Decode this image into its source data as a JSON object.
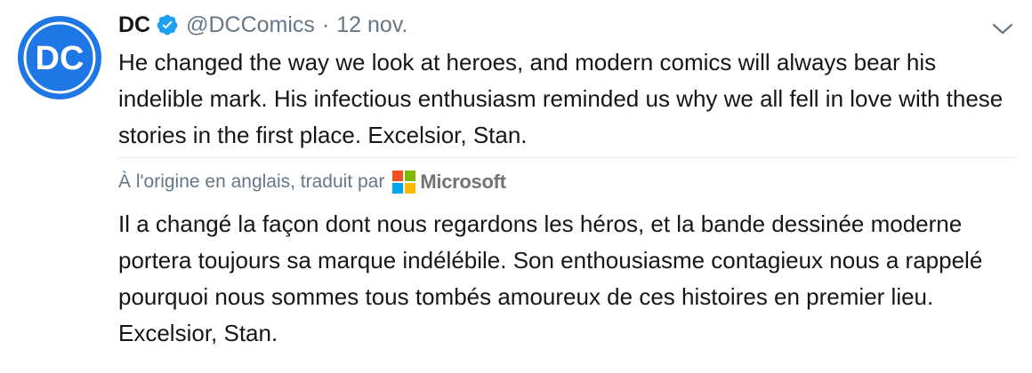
{
  "tweet": {
    "display_name": "DC",
    "handle": "@DCComics",
    "separator": "·",
    "timestamp": "12 nov.",
    "text": "He changed the way we look at heroes, and modern comics will always bear his indelible mark. His infectious enthusiasm reminded us why we all fell in love with these stories in the first place. Excelsior, Stan.",
    "avatar_text": "DC",
    "icons": {
      "verified": "verified-badge-icon",
      "caret": "chevron-down-icon",
      "translator_logo": "microsoft-logo-icon"
    }
  },
  "translation": {
    "label": "À l'origine en anglais, traduit par",
    "provider": "Microsoft",
    "text": "Il a changé la façon dont nous regardons les héros, et la bande dessinée moderne portera toujours sa marque indélébile. Son enthousiasme contagieux nous a rappelé pourquoi nous sommes tous tombés amoureux de ces histoires en premier lieu. Excelsior, Stan."
  },
  "colors": {
    "avatar_blue": "#1f77e6",
    "verified_blue": "#1da1f2",
    "secondary_text": "#657786",
    "primary_text": "#14171a",
    "ms_red": "#f25022",
    "ms_green": "#7fba00",
    "ms_blue": "#00a4ef",
    "ms_yellow": "#ffb900"
  }
}
